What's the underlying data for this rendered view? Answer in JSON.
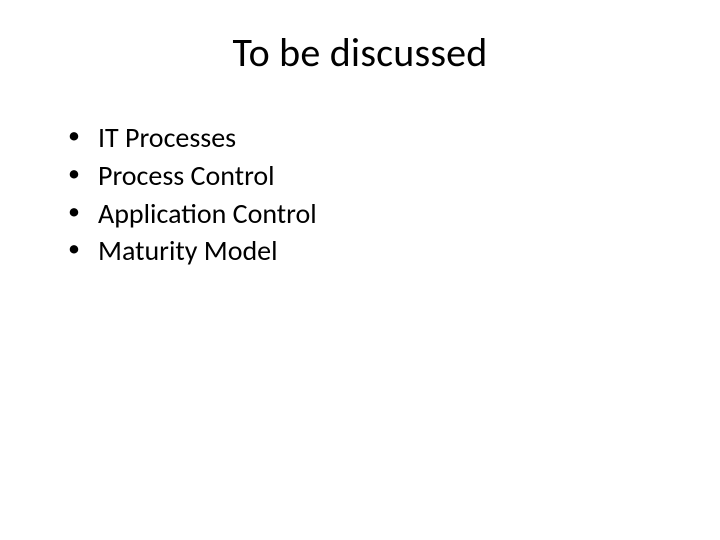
{
  "title": "To be discussed",
  "bullets": {
    "0": "IT Processes",
    "1": "Process Control",
    "2": "Application Control",
    "3": "Maturity Model"
  }
}
